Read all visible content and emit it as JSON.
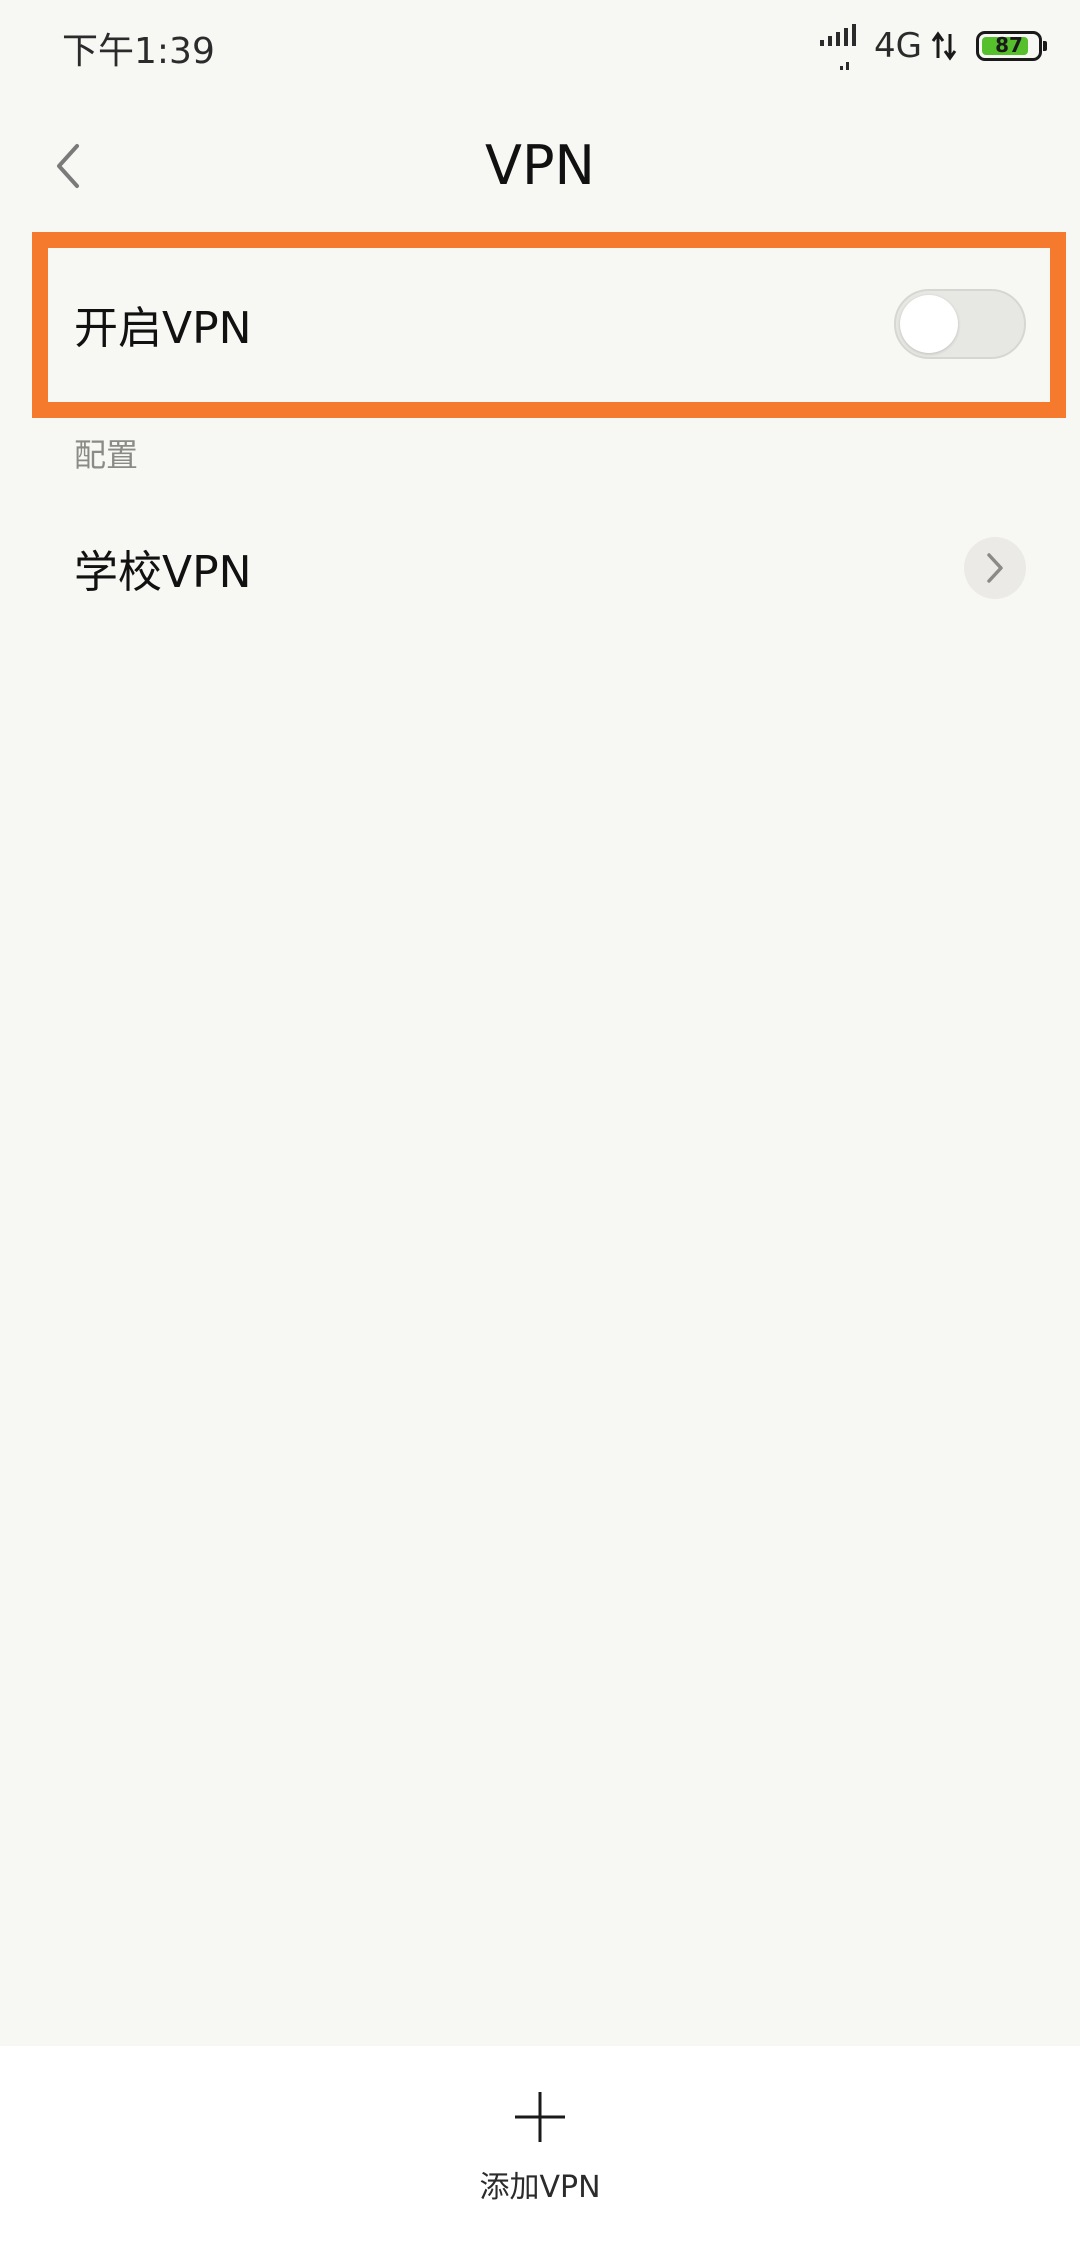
{
  "status_bar": {
    "time": "下午1:39",
    "network": "4G",
    "battery_level": "87",
    "battery_fill_percent": 87
  },
  "header": {
    "title": "VPN",
    "back_icon": "chevron-left-icon"
  },
  "vpn_toggle": {
    "label": "开启VPN",
    "enabled": false
  },
  "section": {
    "header": "配置"
  },
  "config_items": [
    {
      "label": "学校VPN",
      "icon": "chevron-right-icon"
    }
  ],
  "bottom": {
    "add_label": "添加VPN",
    "add_icon": "plus-icon"
  },
  "colors": {
    "highlight": "#f57a2d",
    "battery": "#56c02c",
    "background": "#f7f7f3"
  }
}
